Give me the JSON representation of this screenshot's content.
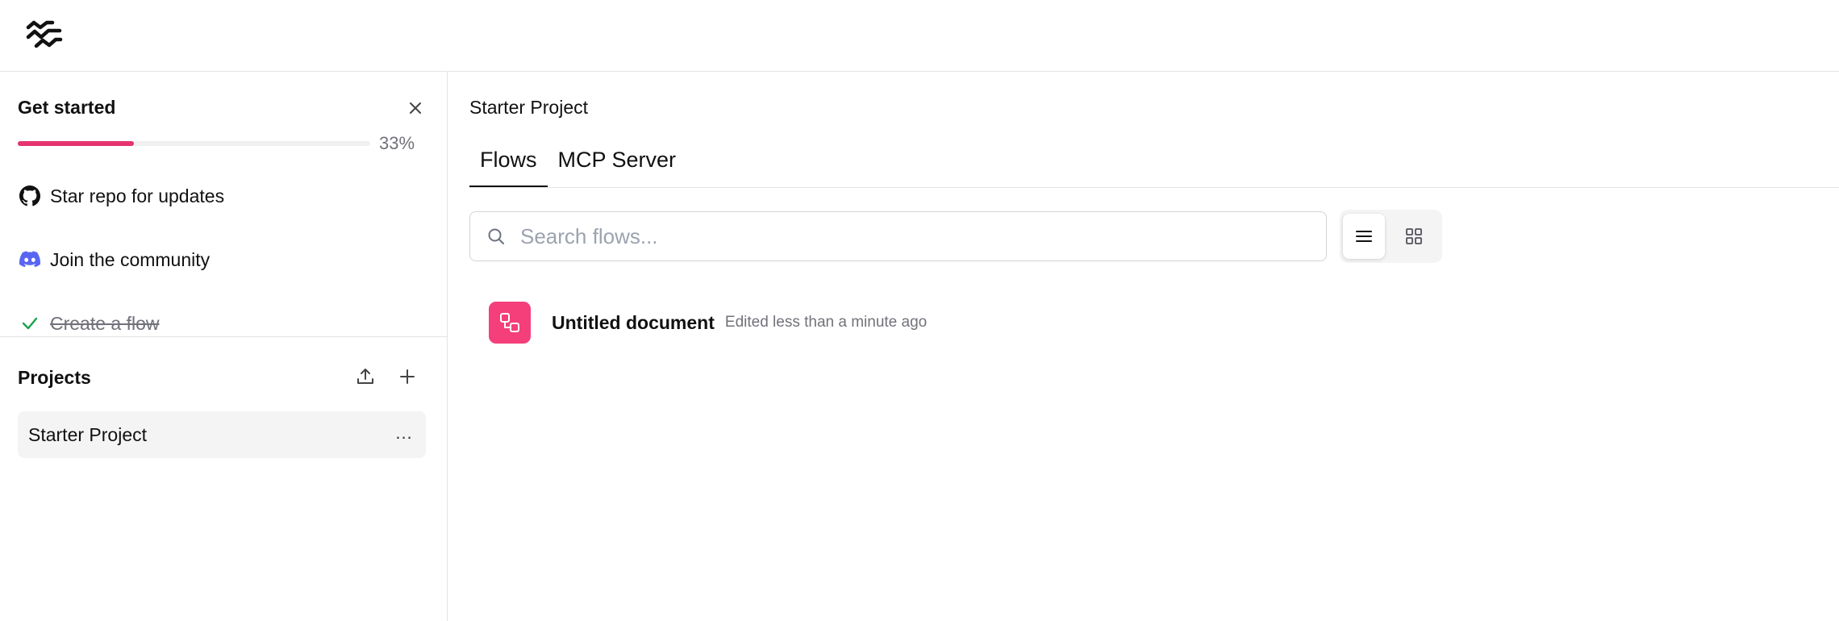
{
  "get_started": {
    "title": "Get started",
    "progress_percent": 33,
    "progress_label": "33%",
    "items": [
      {
        "label": "Star repo for updates",
        "icon": "github-icon",
        "done": false
      },
      {
        "label": "Join the community",
        "icon": "discord-icon",
        "done": false
      },
      {
        "label": "Create a flow",
        "icon": "check-icon",
        "done": true
      }
    ]
  },
  "projects": {
    "title": "Projects",
    "items": [
      {
        "name": "Starter Project",
        "more_label": "..."
      }
    ]
  },
  "main": {
    "title": "Starter Project",
    "tabs": [
      {
        "label": "Flows",
        "active": true
      },
      {
        "label": "MCP Server",
        "active": false
      }
    ],
    "search": {
      "placeholder": "Search flows...",
      "value": ""
    },
    "view_mode": "list",
    "flows": [
      {
        "name": "Untitled document",
        "edited": "Edited less than a minute ago"
      }
    ]
  },
  "colors": {
    "accent": "#e5336f",
    "flow_icon_bg": "#f43f7a",
    "check": "#16a34a",
    "discord": "#5865f2"
  }
}
